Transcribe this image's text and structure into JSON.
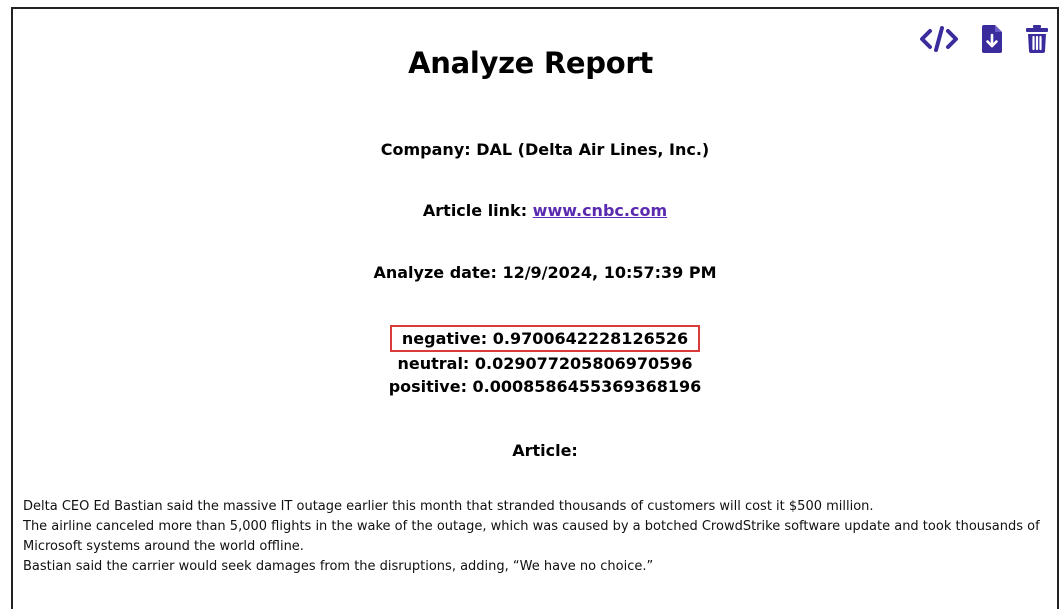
{
  "header": {
    "title": "Analyze Report"
  },
  "toolbar": {
    "code_icon": "code-icon",
    "download_icon": "file-download-icon",
    "delete_icon": "trash-icon",
    "icon_color": "#3b2c9e"
  },
  "report": {
    "company_label": "Company:",
    "company_value": "DAL (Delta Air Lines, Inc.)",
    "article_link_label": "Article link:",
    "article_link_text": "www.cnbc.com",
    "analyze_date_label": "Analyze date:",
    "analyze_date_value": "12/9/2024, 10:57:39 PM"
  },
  "sentiment": {
    "negative_label": "negative:",
    "negative_value": "0.9700642228126526",
    "neutral_label": "neutral:",
    "neutral_value": "0.029077205806970596",
    "positive_label": "positive:",
    "positive_value": "0.0008586455369368196",
    "highlight_color": "#d93a3a"
  },
  "article": {
    "heading": "Article:",
    "paragraphs": [
      "Delta CEO Ed Bastian said the massive IT outage earlier this month that stranded thousands of customers will cost it $500 million.",
      "The airline canceled more than 5,000 flights in the wake of the outage, which was caused by a botched CrowdStrike software update and took thousands of Microsoft systems around the world offline.",
      "Bastian said the carrier would seek damages from the disruptions, adding, “We have no choice.”"
    ]
  }
}
